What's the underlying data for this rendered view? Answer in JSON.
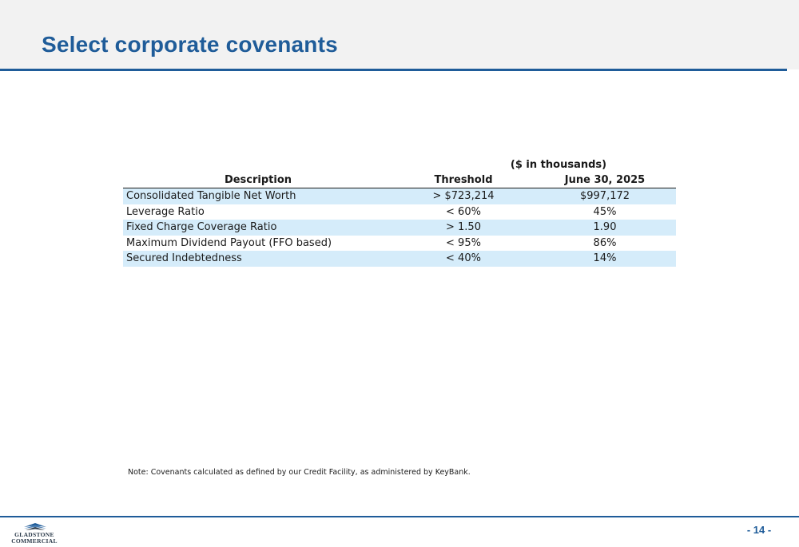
{
  "header": {
    "title": "Select corporate covenants"
  },
  "table": {
    "units_caption": "($ in thousands)",
    "columns": [
      "Description",
      "Threshold",
      "June 30, 2025"
    ],
    "rows": [
      {
        "description": "Consolidated Tangible Net Worth",
        "threshold": "> $723,214",
        "value": "$997,172"
      },
      {
        "description": "Leverage Ratio",
        "threshold": "< 60%",
        "value": "45%"
      },
      {
        "description": "Fixed Charge Coverage Ratio",
        "threshold": "> 1.50",
        "value": "1.90"
      },
      {
        "description": "Maximum Dividend Payout (FFO based)",
        "threshold": "< 95%",
        "value": "86%"
      },
      {
        "description": "Secured Indebtedness",
        "threshold": "< 40%",
        "value": "14%"
      }
    ]
  },
  "note": "Note: Covenants calculated as defined by our Credit Facility, as administered by KeyBank.",
  "footer": {
    "logo_line1": "GLADSTONE",
    "logo_line2": "COMMERCIAL",
    "page_number": "- 14 -"
  },
  "colors": {
    "accent": "#1f5c99",
    "row_shade": "#d5ecfa",
    "header_band": "#f2f2f2"
  }
}
